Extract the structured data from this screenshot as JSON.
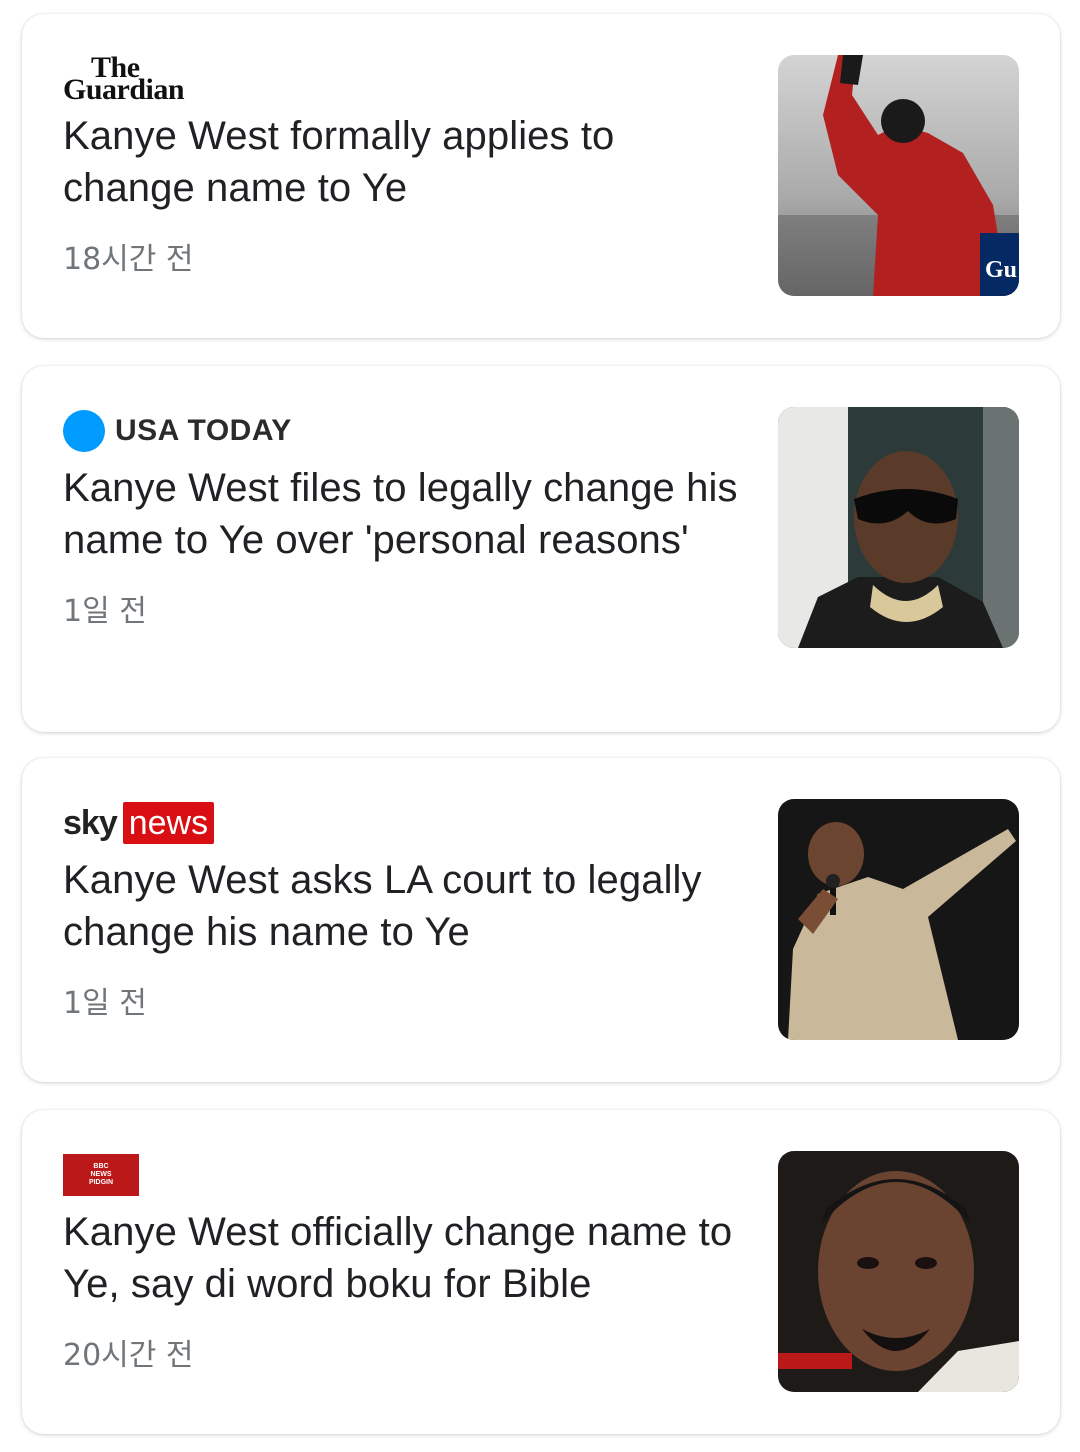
{
  "colors": {
    "usa_today_blue": "#009bff",
    "sky_news_red": "#d80e13",
    "bbc_red": "#bb1919",
    "headline": "#202124",
    "time": "#70757a"
  },
  "articles": [
    {
      "source": "The Guardian",
      "logo_lines": [
        "The",
        "Guardian"
      ],
      "headline": "Kanye West formally applies to change name to Ye",
      "time": "18시간 전",
      "thumb_icon": "guardian-photo-red-hoodie"
    },
    {
      "source": "USA TODAY",
      "logo_text": "USA TODAY",
      "headline": "Kanye West files to legally change his name to Ye over 'personal reasons'",
      "time": "1일 전",
      "thumb_icon": "photo-sunglasses-portrait"
    },
    {
      "source": "Sky News",
      "logo_sky": "sky",
      "logo_news": "news",
      "headline": "Kanye West asks LA court to legally change his name to Ye",
      "time": "1일 전",
      "thumb_icon": "photo-performer-microphone"
    },
    {
      "source": "BBC News Pidgin",
      "logo_lines": [
        "BBC",
        "NEWS",
        "PIDGIN"
      ],
      "headline": "Kanye West officially change name to Ye, say di word boku for Bible",
      "time": "20시간 전",
      "thumb_icon": "photo-portrait-closeup"
    }
  ]
}
